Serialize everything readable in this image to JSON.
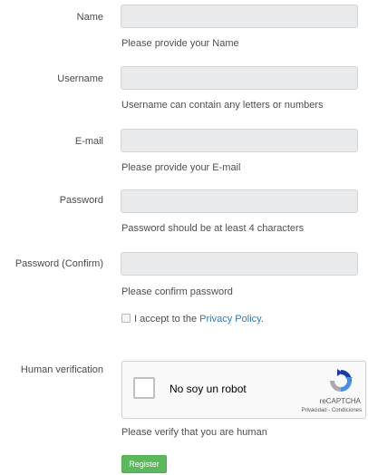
{
  "form": {
    "fields": [
      {
        "label": "Name",
        "value": "",
        "help": "Please provide your Name"
      },
      {
        "label": "Username",
        "value": "",
        "help": "Username can contain any letters or numbers"
      },
      {
        "label": "E-mail",
        "value": "",
        "help": "Please provide your E-mail"
      },
      {
        "label": "Password",
        "value": "",
        "help": "Password should be at least 4 characters"
      },
      {
        "label": "Password (Confirm)",
        "value": "",
        "help": "Please confirm password"
      }
    ],
    "agree": {
      "checked": false,
      "text": "I accept to the",
      "link_text": "Privacy Policy",
      "suffix": "."
    },
    "human_verification": {
      "label": "Human verification",
      "checkbox_label": "No soy un robot",
      "brand": "reCAPTCHA",
      "terms": "Privacidad - Condiciones",
      "help": "Please verify that you are human"
    },
    "register_label": "Register"
  },
  "colors": {
    "input_bg": "#e9eaeb",
    "link": "#337ab7",
    "register_bg": "#5cb85c",
    "recaptcha_blue": "#4a90e2"
  }
}
